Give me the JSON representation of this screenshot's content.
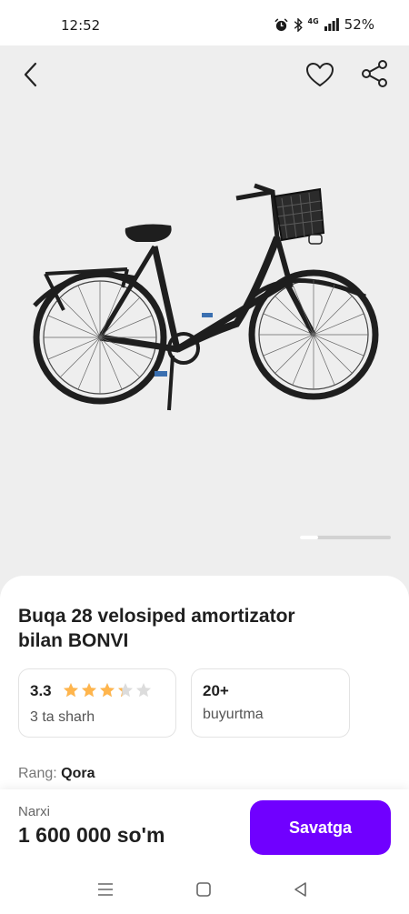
{
  "status_bar": {
    "time": "12:52",
    "network": "4G",
    "battery": "52%",
    "icons": [
      "alarm-icon",
      "bluetooth-icon",
      "signal-icon"
    ]
  },
  "gallery": {
    "icons": [
      "chevron-left-icon",
      "heart-icon",
      "share-icon"
    ],
    "background_color": "#eeeeee"
  },
  "product": {
    "title_line1": "Buqa 28 velosiped amortizator",
    "title_line2": "bilan BONVI",
    "rating": {
      "value": "3.3",
      "stars": 3.3,
      "max_stars": 5,
      "reviews": "3 ta sharh"
    },
    "orders": {
      "value": "20+",
      "label": "buyurtma"
    },
    "color": {
      "label": "Rang:",
      "value": "Qora"
    }
  },
  "purchase": {
    "price_label": "Narxi",
    "price": "1 600 000 so'm",
    "cart_button": "Savatga",
    "accent_color": "#7000ff"
  },
  "navigation": {
    "icons": [
      "menu-icon",
      "home-icon",
      "back-triangle-icon"
    ]
  }
}
